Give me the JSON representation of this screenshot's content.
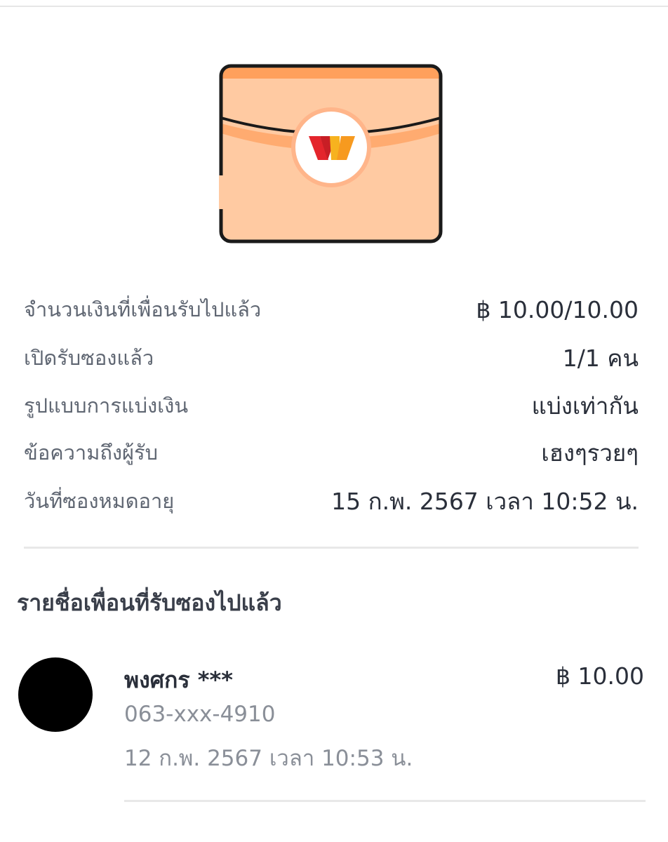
{
  "envelope": {
    "icon": "red-envelope-icon",
    "colors": {
      "body": "#ffcaa2",
      "flap_band": "#ffab70",
      "top_band": "#ffa05c",
      "outline": "#1a1a1a",
      "seal_ring": "#ffb58a",
      "logo_red": "#e4252c",
      "logo_orange": "#f79a1f"
    }
  },
  "details": [
    {
      "label": "จำนวนเงินที่เพื่อนรับไปแล้ว",
      "value": "฿ 10.00/10.00"
    },
    {
      "label": "เปิดรับซองแล้ว",
      "value": "1/1 คน"
    },
    {
      "label": "รูปแบบการแบ่งเงิน",
      "value": "แบ่งเท่ากัน"
    },
    {
      "label": "ข้อความถึงผู้รับ",
      "value": "เฮงๆรวยๆ"
    },
    {
      "label": "วันที่ซองหมดอายุ",
      "value": "15 ก.พ. 2567 เวลา 10:52 น."
    }
  ],
  "recipients_section": {
    "title": "รายชื่อเพื่อนที่รับซองไปแล้ว",
    "items": [
      {
        "name": "พงศกร ***",
        "phone": "063-xxx-4910",
        "date": "12 ก.พ. 2567 เวลา 10:53 น.",
        "amount": "฿ 10.00"
      }
    ]
  }
}
